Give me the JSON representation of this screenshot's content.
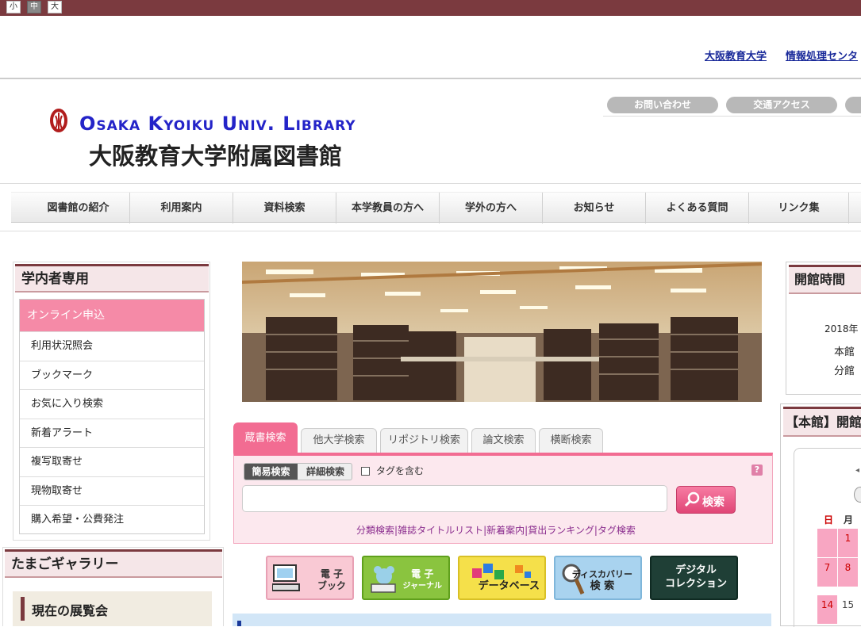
{
  "font_size_controls": [
    "小",
    "中",
    "大"
  ],
  "top_links": [
    "大阪教育大学",
    "情報処理センタ"
  ],
  "header": {
    "logo_en": "Osaka Kyoiku Univ. Library",
    "logo_jp": "大阪教育大学附属図書館",
    "pills": [
      "お問い合わせ",
      "交通アクセス"
    ]
  },
  "gnav": [
    "図書館の紹介",
    "利用案内",
    "資料検索",
    "本学教員の方へ",
    "学外の方へ",
    "お知らせ",
    "よくある質問",
    "リンク集"
  ],
  "login_box": {
    "title": "学内者専用",
    "items": [
      "オンライン申込",
      "利用状況照会",
      "ブックマーク",
      "お気に入り検索",
      "新着アラート",
      "複写取寄せ",
      "現物取寄せ",
      "購入希望・公費発注"
    ]
  },
  "gallery": {
    "title": "たまごギャラリー",
    "sub": "現在の展覧会"
  },
  "search": {
    "tabs": [
      "蔵書検索",
      "他大学検索",
      "リポジトリ検索",
      "論文検索",
      "横断検索"
    ],
    "mode_simple": "簡易検索",
    "mode_detail": "詳細検索",
    "tag_label": "タグを含む",
    "help": "?",
    "input_value": "",
    "button": "検索",
    "sublinks": [
      "分類検索",
      "雑誌タイトルリスト",
      "新着案内",
      "貸出ランキング",
      "タグ検索"
    ]
  },
  "banners": [
    {
      "l1": "電 子",
      "l2": "ブック",
      "bg": "#f9c9d4",
      "fg": "#333"
    },
    {
      "l1": "電 子",
      "l2": "ジャーナル",
      "bg": "#8ac43f",
      "fg": "#fff"
    },
    {
      "l1": "",
      "l2": "データベース",
      "bg": "#f5e04a",
      "fg": "#222"
    },
    {
      "l1": "ディスカバリー",
      "l2": "検 索",
      "bg": "#a9d3ef",
      "fg": "#222"
    },
    {
      "l1": "デジタル",
      "l2": "コレクション",
      "bg": "#1f3f36",
      "fg": "#fff"
    }
  ],
  "hours": {
    "title": "開館時間",
    "year": "2018年",
    "main": "本館",
    "branch": "分館"
  },
  "calendar": {
    "title": "【本館】開館",
    "weekday_sun": "日",
    "weekday_mon": "月",
    "days": [
      {
        "sun": "",
        "mon": "1"
      },
      {
        "sun": "7",
        "mon": "8"
      },
      {
        "sun": "14",
        "mon": "15"
      }
    ]
  },
  "colors": {
    "brand": "#7b3a3f",
    "accent_pink": "#f26c92",
    "link": "#1a2a9a"
  }
}
